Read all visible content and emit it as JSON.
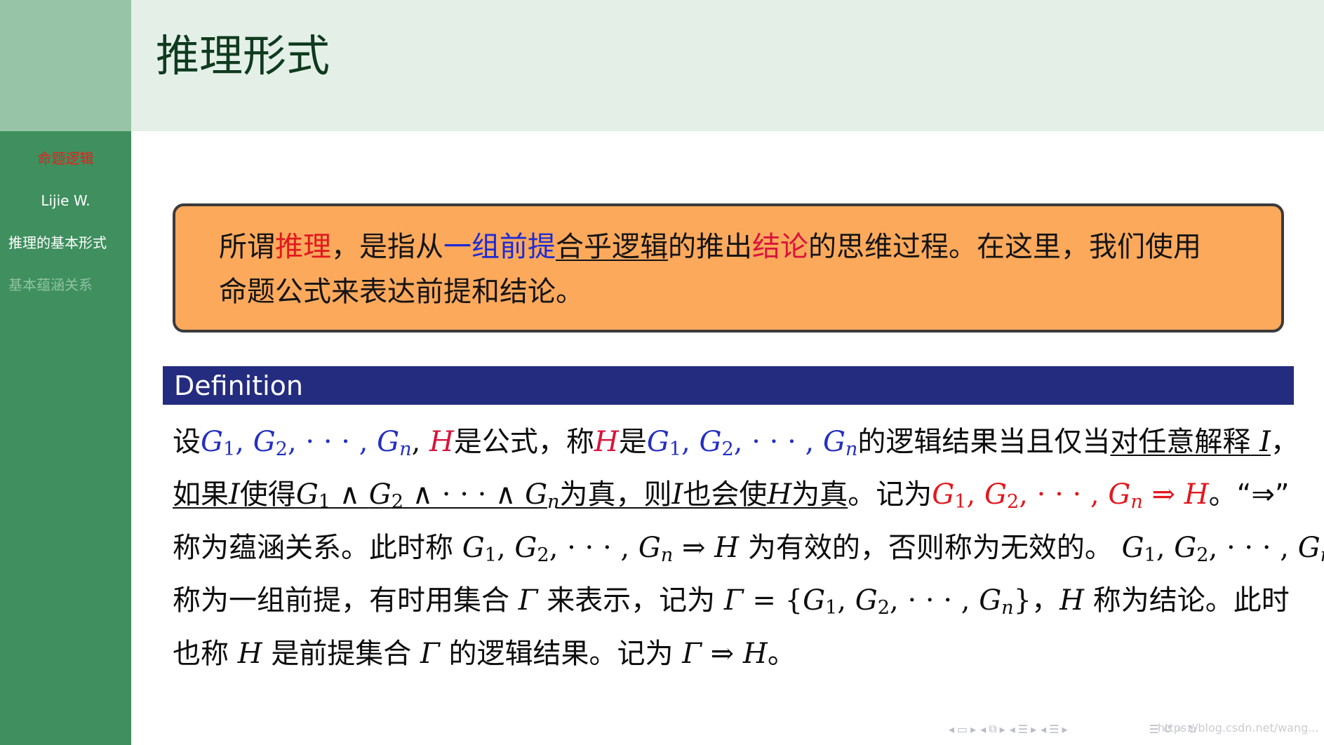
{
  "header": {
    "title": "推理形式"
  },
  "sidebar": {
    "title": "命题逻辑",
    "author": "Lijie W.",
    "current_section": "推理的基本形式",
    "other_section": "基本蕴涵关系"
  },
  "note": {
    "p1": "所谓",
    "w_tuili": "推理",
    "p2": "，是指从",
    "w_yizu": "一组前提",
    "w_hehu": "合乎逻辑",
    "p3": "的推出",
    "w_jielun": "结论",
    "p4": "的思维过程。在这里，我们使用",
    "line2": "命题公式来表达前提和结论。"
  },
  "definition": {
    "title": "Definition",
    "l1_she": "设",
    "l1_shigongshi": "是公式，称",
    "l1_shi": "是",
    "l1_de": "的逻辑结果当且仅当",
    "l1_u": "对任意解释",
    "l1_comma": "，",
    "l2_ru": "如果",
    "l2_shide": "使得",
    "l2_weizhen": "为真，则",
    "l2_yehui": "也会使",
    "l2_weizhen2": "为真",
    "l2_jiwei": "。记为",
    "l2_end": "。“⇒”",
    "l3_a": "称为蕴涵关系。此时称",
    "l3_b": "为有效的，否则称为无效的。",
    "l4_a": "称为一组前提，有时用集合",
    "l4_b": "来表示，记为",
    "l4_c": "，",
    "l4_d": "称为结论。此时",
    "l5_a": "也称",
    "l5_b": "是前提集合",
    "l5_c": "的逻辑结果。记为",
    "l5_end": "。"
  },
  "footer": {
    "watermark": "https://blog.csdn.net/wang..."
  },
  "icons": [
    "arrow-left-icon",
    "frame-icon",
    "arrow-right-icon",
    "subsection-icon",
    "section-icon",
    "toc-icon",
    "back-icon",
    "search-icon",
    "zoom-icon"
  ],
  "colors": {
    "sidebar": "#3f8f5f",
    "header": "#e3efe7",
    "note_box": "#fca95c",
    "definition_bar": "#242c80",
    "red": "#e2181e",
    "blue": "#1d2bd6"
  }
}
